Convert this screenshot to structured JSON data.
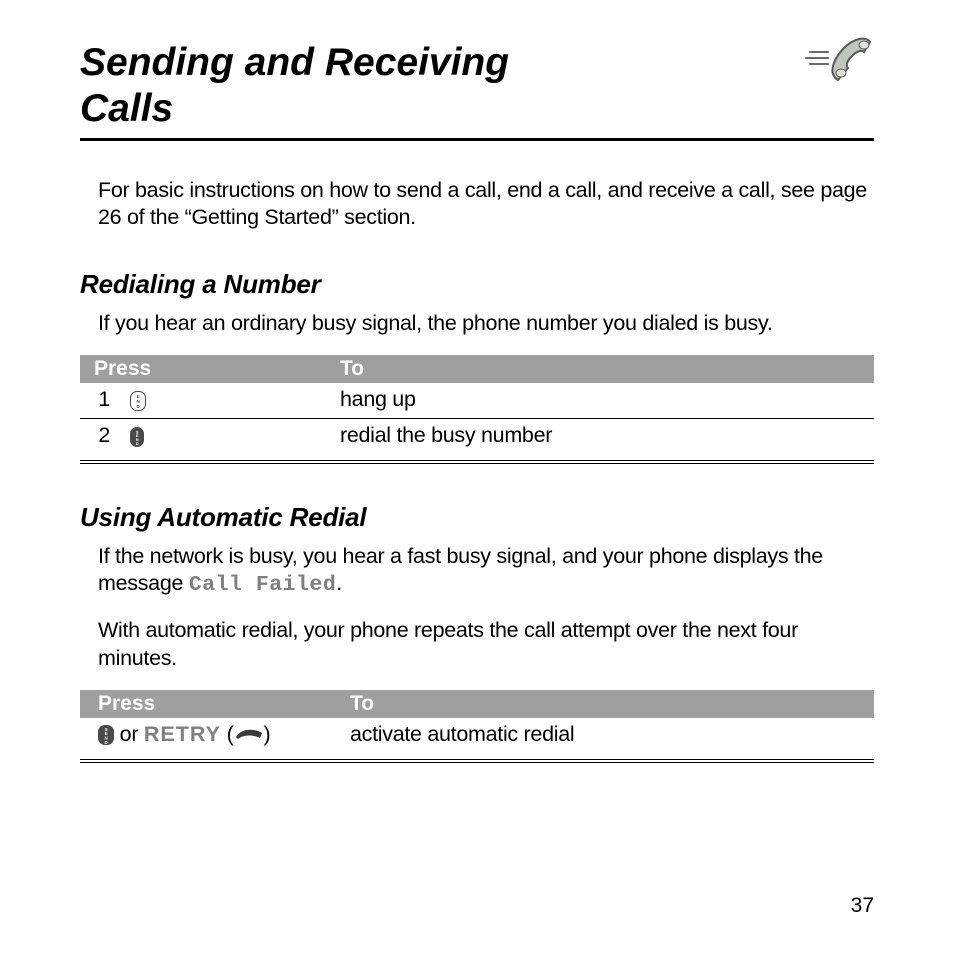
{
  "chapter_title_line1": "Sending and Receiving",
  "chapter_title_line2": "Calls",
  "intro_paragraph": "For basic instructions on how to send a call, end a call, and receive a call, see page 26 of the “Getting Started” section.",
  "section1": {
    "heading": "Redialing a Number",
    "paragraph": "If you hear an ordinary busy signal, the phone number you dialed is busy.",
    "table": {
      "headers": [
        "Press",
        "To"
      ],
      "rows": [
        {
          "step": "1",
          "action": "hang up"
        },
        {
          "step": "2",
          "action": "redial the busy number"
        }
      ]
    }
  },
  "section2": {
    "heading": "Using Automatic Redial",
    "paragraph1_pre": "If the network is busy, you hear a fast busy signal, and your phone displays the message ",
    "paragraph1_msg": "Call Failed",
    "paragraph1_post": ".",
    "paragraph2": "With automatic redial, your phone repeats the call attempt over the next four minutes.",
    "table": {
      "headers": [
        "Press",
        "To"
      ],
      "row": {
        "press_or": " or ",
        "press_retry": "RETRY",
        "action": "activate automatic redial"
      }
    }
  },
  "page_number": "37"
}
